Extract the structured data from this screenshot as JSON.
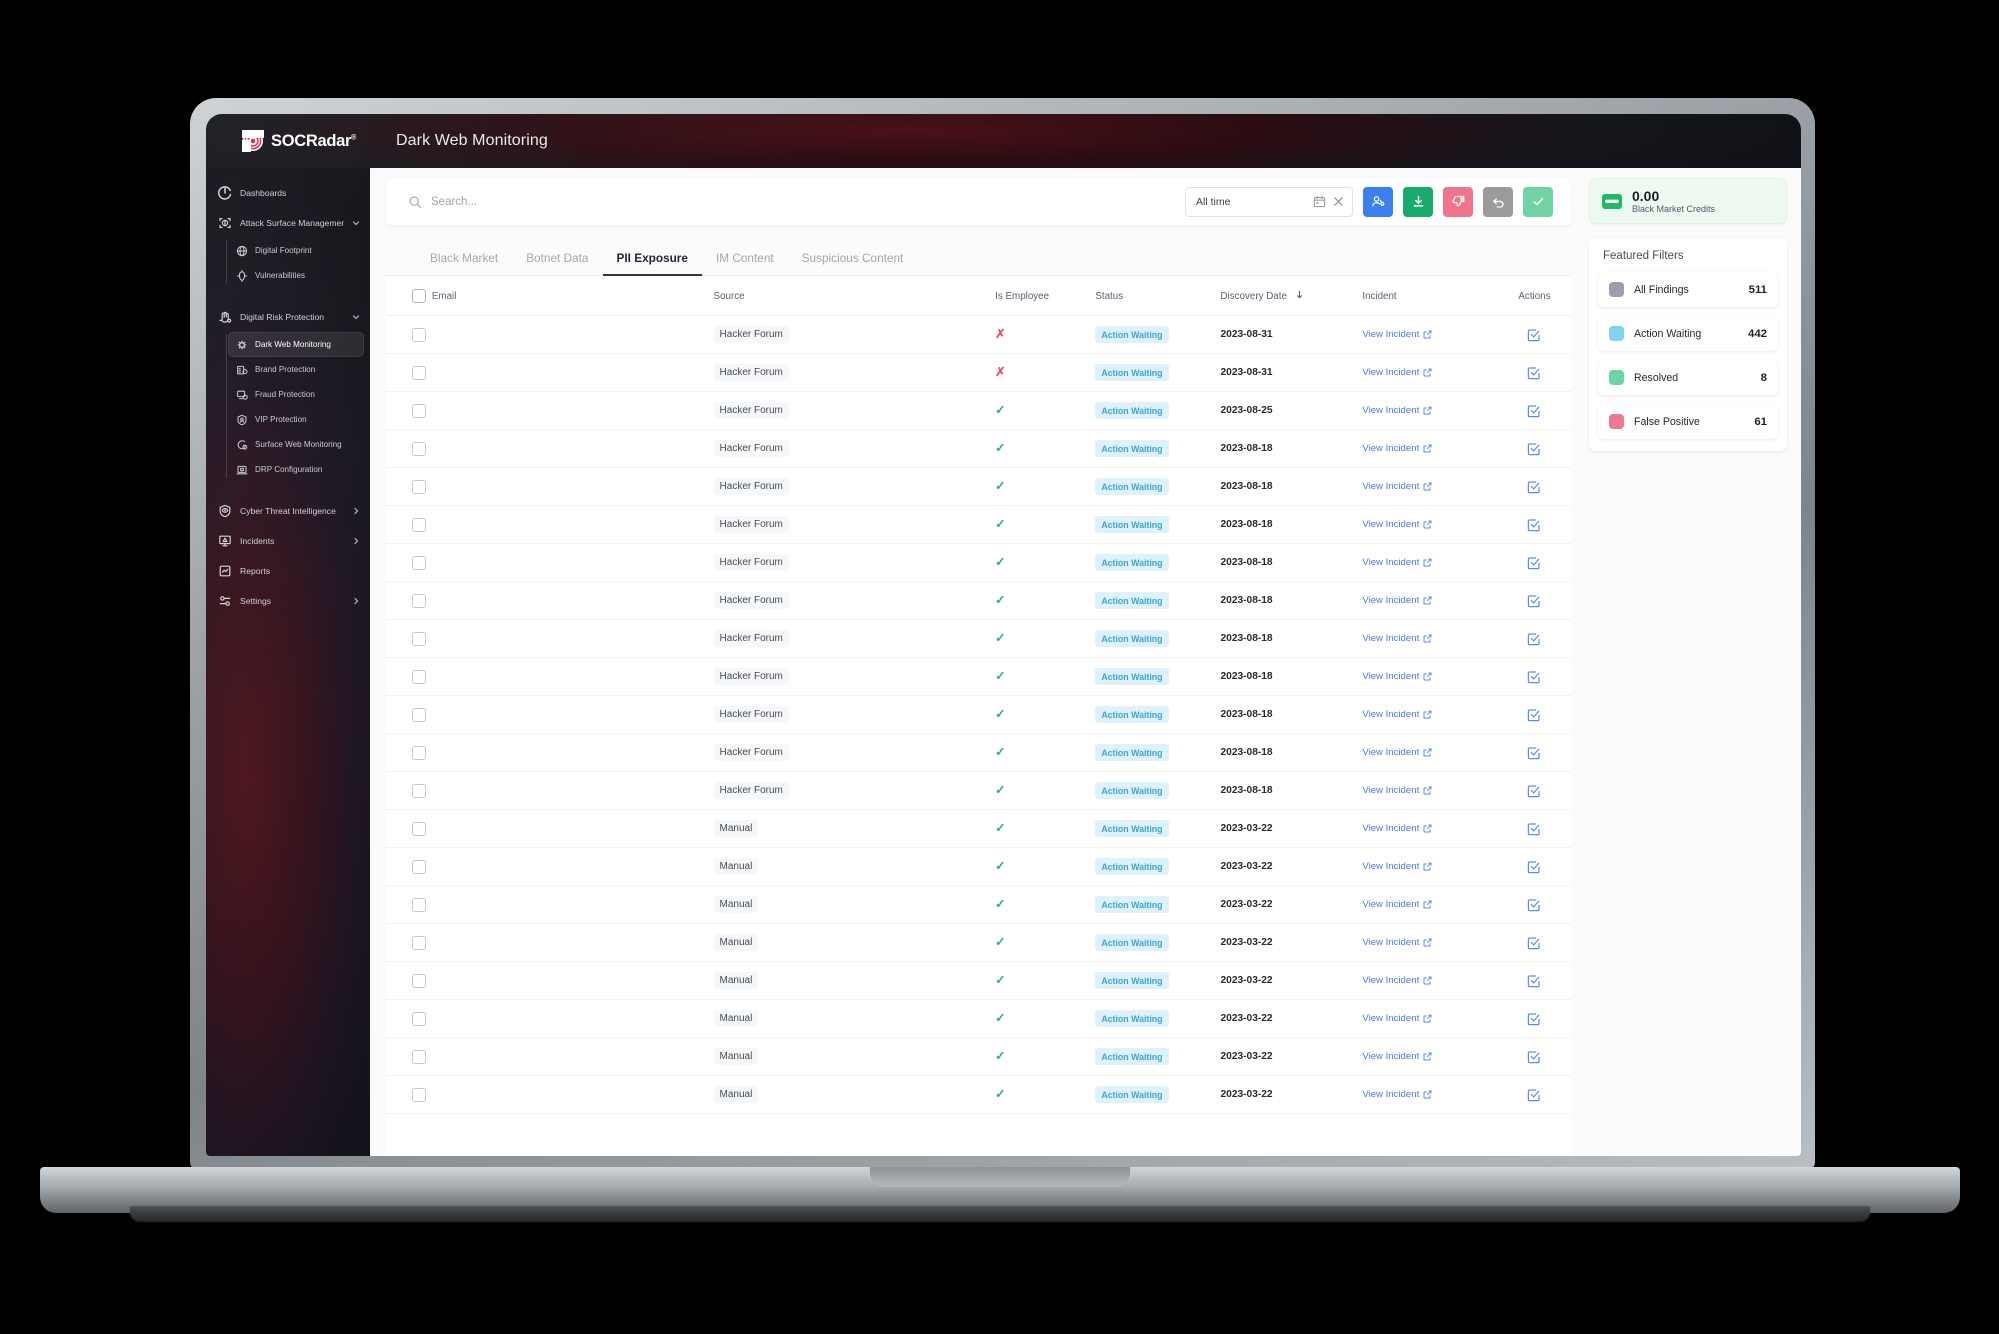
{
  "brand": {
    "name": "SOCRadar",
    "registered": "®",
    "logo_icon": "socradar-logo-icon"
  },
  "header": {
    "title": "Dark Web Monitoring"
  },
  "sidebar": {
    "items": [
      {
        "label": "Dashboards",
        "icon": "dashboard-icon",
        "type": "top",
        "expandable": false
      },
      {
        "label": "Attack Surface Management",
        "icon": "attack-surface-icon",
        "type": "top",
        "expandable": true
      },
      {
        "label": "Digital Footprint",
        "icon": "globe-icon",
        "type": "sub"
      },
      {
        "label": "Vulnerabilities",
        "icon": "vulnerability-icon",
        "type": "sub"
      },
      {
        "label": "Digital Risk Protection",
        "icon": "digital-risk-icon",
        "type": "top",
        "expandable": true
      },
      {
        "label": "Dark Web Monitoring",
        "icon": "dark-web-icon",
        "type": "sub",
        "active": true
      },
      {
        "label": "Brand Protection",
        "icon": "brand-protection-icon",
        "type": "sub"
      },
      {
        "label": "Fraud Protection",
        "icon": "fraud-protection-icon",
        "type": "sub"
      },
      {
        "label": "VIP Protection",
        "icon": "vip-protection-icon",
        "type": "sub"
      },
      {
        "label": "Surface Web Monitoring",
        "icon": "surface-web-icon",
        "type": "sub"
      },
      {
        "label": "DRP Configuration",
        "icon": "drp-config-icon",
        "type": "sub"
      },
      {
        "label": "Cyber Threat Intelligence",
        "icon": "threat-intel-icon",
        "type": "top",
        "expandable": true
      },
      {
        "label": "Incidents",
        "icon": "incidents-icon",
        "type": "top",
        "expandable": true
      },
      {
        "label": "Reports",
        "icon": "reports-icon",
        "type": "top",
        "expandable": false
      },
      {
        "label": "Settings",
        "icon": "settings-icon",
        "type": "top",
        "expandable": true
      }
    ]
  },
  "toolbar": {
    "search_placeholder": "Search...",
    "search_value": "",
    "date_filter_value": "All time",
    "buttons": [
      {
        "name": "assign-button",
        "icon": "user-share-icon",
        "color": "#3b7ff0"
      },
      {
        "name": "download-button",
        "icon": "download-icon",
        "color": "#18ab6d"
      },
      {
        "name": "false-positive-button",
        "icon": "thumbs-down-icon",
        "color": "#f0748c"
      },
      {
        "name": "undo-button",
        "icon": "undo-arrow-icon",
        "color": "#9b9b9b"
      },
      {
        "name": "resolve-button",
        "icon": "check-icon",
        "color": "#6fd3a3"
      }
    ]
  },
  "tabs": [
    {
      "label": "Black Market",
      "active": false
    },
    {
      "label": "Botnet Data",
      "active": false
    },
    {
      "label": "PII Exposure",
      "active": true
    },
    {
      "label": "IM Content",
      "active": false
    },
    {
      "label": "Suspicious Content",
      "active": false
    }
  ],
  "table": {
    "columns": [
      "Email",
      "Source",
      "Is Employee",
      "Status",
      "Discovery Date",
      "Incident",
      "Actions"
    ],
    "sort_column": "Discovery Date",
    "sort_direction": "desc",
    "incident_link_label": "View Incident",
    "rows": [
      {
        "email": "",
        "email_redacted": true,
        "redact_width": 96,
        "source": "Hacker Forum",
        "is_employee": false,
        "status": "Action Waiting",
        "discovery_date": "2023-08-31"
      },
      {
        "email": "",
        "email_redacted": true,
        "redact_width": 166,
        "source": "Hacker Forum",
        "is_employee": false,
        "status": "Action Waiting",
        "discovery_date": "2023-08-31"
      },
      {
        "email": "",
        "email_redacted": true,
        "redact_width": 122,
        "source": "Hacker Forum",
        "is_employee": true,
        "status": "Action Waiting",
        "discovery_date": "2023-08-25"
      },
      {
        "email": "",
        "email_redacted": true,
        "redact_width": 146,
        "source": "Hacker Forum",
        "is_employee": true,
        "status": "Action Waiting",
        "discovery_date": "2023-08-18"
      },
      {
        "email": "",
        "email_redacted": true,
        "redact_width": 186,
        "source": "Hacker Forum",
        "is_employee": true,
        "status": "Action Waiting",
        "discovery_date": "2023-08-18"
      },
      {
        "email": "",
        "email_redacted": true,
        "redact_width": 134,
        "source": "Hacker Forum",
        "is_employee": true,
        "status": "Action Waiting",
        "discovery_date": "2023-08-18"
      },
      {
        "email": "",
        "email_redacted": true,
        "redact_width": 152,
        "source": "Hacker Forum",
        "is_employee": true,
        "status": "Action Waiting",
        "discovery_date": "2023-08-18"
      },
      {
        "email": "",
        "email_redacted": true,
        "redact_width": 158,
        "source": "Hacker Forum",
        "is_employee": true,
        "status": "Action Waiting",
        "discovery_date": "2023-08-18"
      },
      {
        "email": "",
        "email_redacted": true,
        "redact_width": 150,
        "source": "Hacker Forum",
        "is_employee": true,
        "status": "Action Waiting",
        "discovery_date": "2023-08-18"
      },
      {
        "email": "",
        "email_redacted": true,
        "redact_width": 148,
        "source": "Hacker Forum",
        "is_employee": true,
        "status": "Action Waiting",
        "discovery_date": "2023-08-18"
      },
      {
        "email": "",
        "email_redacted": true,
        "redact_width": 144,
        "source": "Hacker Forum",
        "is_employee": true,
        "status": "Action Waiting",
        "discovery_date": "2023-08-18"
      },
      {
        "email": "",
        "email_redacted": true,
        "redact_width": 126,
        "source": "Hacker Forum",
        "is_employee": true,
        "status": "Action Waiting",
        "discovery_date": "2023-08-18"
      },
      {
        "email": "",
        "email_redacted": true,
        "redact_width": 132,
        "source": "Hacker Forum",
        "is_employee": true,
        "status": "Action Waiting",
        "discovery_date": "2023-08-18"
      },
      {
        "email": "",
        "email_redacted": true,
        "redact_width": 110,
        "source": "Manual",
        "is_employee": true,
        "status": "Action Waiting",
        "discovery_date": "2023-03-22"
      },
      {
        "email": "",
        "email_redacted": true,
        "redact_width": 108,
        "source": "Manual",
        "is_employee": true,
        "status": "Action Waiting",
        "discovery_date": "2023-03-22"
      },
      {
        "email": "",
        "email_redacted": true,
        "redact_width": 118,
        "source": "Manual",
        "is_employee": true,
        "status": "Action Waiting",
        "discovery_date": "2023-03-22"
      },
      {
        "email": "",
        "email_redacted": true,
        "redact_width": 104,
        "source": "Manual",
        "is_employee": true,
        "status": "Action Waiting",
        "discovery_date": "2023-03-22"
      },
      {
        "email": "",
        "email_redacted": true,
        "redact_width": 106,
        "source": "Manual",
        "is_employee": true,
        "status": "Action Waiting",
        "discovery_date": "2023-03-22"
      },
      {
        "email": "",
        "email_redacted": true,
        "redact_width": 140,
        "source": "Manual",
        "is_employee": true,
        "status": "Action Waiting",
        "discovery_date": "2023-03-22"
      },
      {
        "email": "",
        "email_redacted": true,
        "redact_width": 124,
        "source": "Manual",
        "is_employee": true,
        "status": "Action Waiting",
        "discovery_date": "2023-03-22"
      },
      {
        "email": "",
        "email_redacted": true,
        "redact_width": 120,
        "source": "Manual",
        "is_employee": true,
        "status": "Action Waiting",
        "discovery_date": "2023-03-22"
      }
    ]
  },
  "rail": {
    "credits": {
      "value": "0.00",
      "label": "Black Market Credits",
      "icon": "credit-card-icon"
    },
    "filters_title": "Featured Filters",
    "filters": [
      {
        "label": "All Findings",
        "count": "511",
        "color": "#9aa0ab"
      },
      {
        "label": "Action Waiting",
        "count": "442",
        "color": "#7fd3ec"
      },
      {
        "label": "Resolved",
        "count": "8",
        "color": "#6bd6a5"
      },
      {
        "label": "False Positive",
        "count": "61",
        "color": "#f0798f"
      }
    ]
  }
}
